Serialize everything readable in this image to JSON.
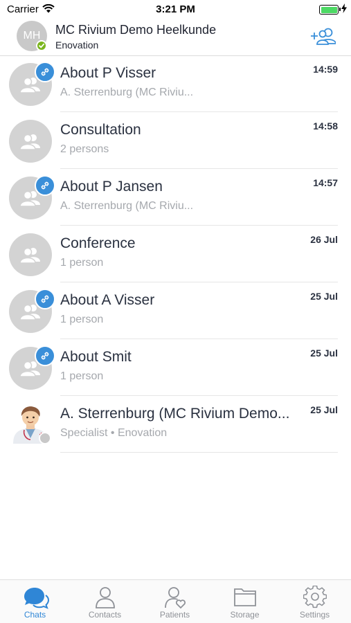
{
  "status_bar": {
    "carrier": "Carrier",
    "time": "3:21 PM"
  },
  "header": {
    "avatar_initials": "MH",
    "title": "MC Rivium Demo Heelkunde",
    "subtitle": "Enovation",
    "add_contact_icon": "add-person-icon"
  },
  "chats": [
    {
      "title": "About P Visser",
      "subtitle": "A. Sterrenburg (MC Riviu...",
      "time": "14:59",
      "linked": true
    },
    {
      "title": "Consultation",
      "subtitle": "2 persons",
      "time": "14:58",
      "linked": false
    },
    {
      "title": "About P Jansen",
      "subtitle": "A. Sterrenburg (MC Riviu...",
      "time": "14:57",
      "linked": true
    },
    {
      "title": "Conference",
      "subtitle": "1 person",
      "time": "26 Jul",
      "linked": false
    },
    {
      "title": "About A Visser",
      "subtitle": "1 person",
      "time": "25 Jul",
      "linked": true
    },
    {
      "title": "About Smit",
      "subtitle": "1 person",
      "time": "25 Jul",
      "linked": true
    },
    {
      "title": "A. Sterrenburg (MC Rivium Demo...",
      "subtitle": "Specialist • Enovation",
      "time": "25 Jul",
      "linked": false
    }
  ],
  "tabs": [
    {
      "label": "Chats",
      "icon": "chat-bubbles-icon",
      "active": true
    },
    {
      "label": "Contacts",
      "icon": "person-icon",
      "active": false
    },
    {
      "label": "Patients",
      "icon": "patient-heart-icon",
      "active": false
    },
    {
      "label": "Storage",
      "icon": "folder-icon",
      "active": false
    },
    {
      "label": "Settings",
      "icon": "gear-icon",
      "active": false
    }
  ],
  "colors": {
    "accent": "#2f86d6",
    "link_badge": "#3a8fd9",
    "online": "#7ab51d"
  }
}
